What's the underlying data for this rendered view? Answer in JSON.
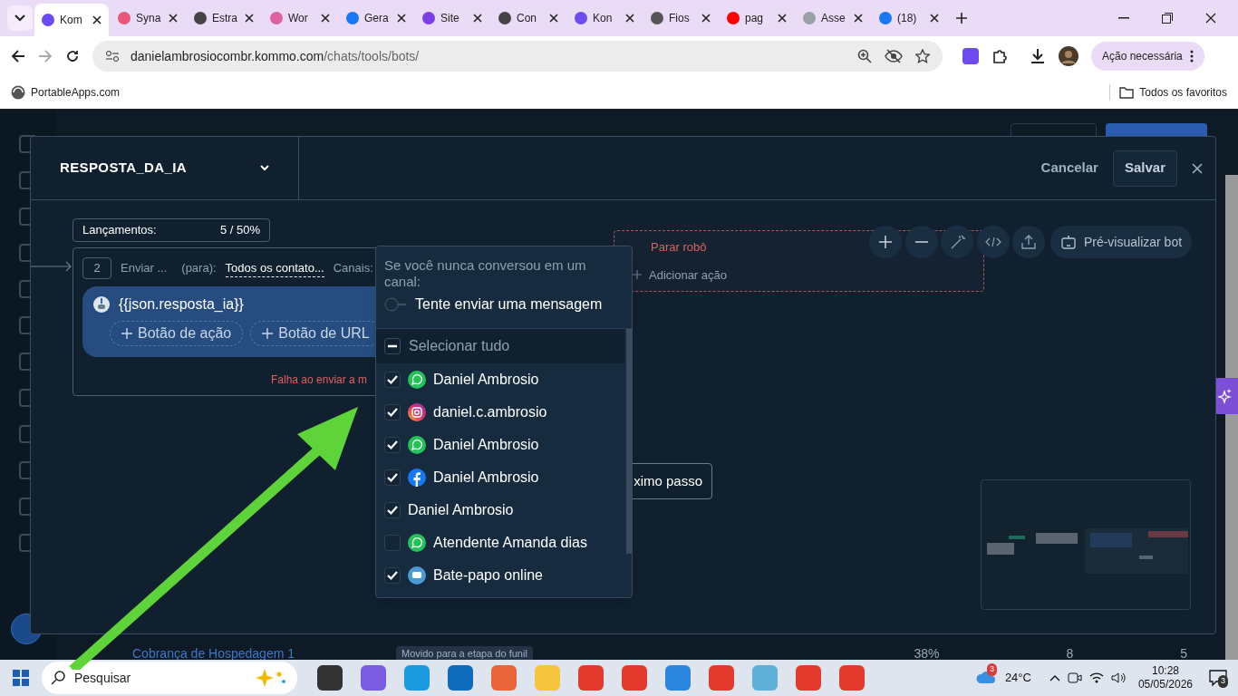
{
  "browser": {
    "tabs": [
      {
        "title": "Kom",
        "color": "#6c4cf0",
        "selected": true
      },
      {
        "title": "Syna",
        "color": "#e8577a",
        "selected": false
      },
      {
        "title": "Estra",
        "color": "#444444",
        "selected": false
      },
      {
        "title": "Wor",
        "color": "#e05fa0",
        "selected": false
      },
      {
        "title": "Gera",
        "color": "#1877f2",
        "selected": false
      },
      {
        "title": "Site",
        "color": "#7b3fe4",
        "selected": false
      },
      {
        "title": "Con",
        "color": "#444444",
        "selected": false
      },
      {
        "title": "Kon",
        "color": "#6c4cf0",
        "selected": false
      },
      {
        "title": "Fios",
        "color": "#555555",
        "selected": false
      },
      {
        "title": "pag",
        "color": "#ff0000",
        "selected": false
      },
      {
        "title": "Asse",
        "color": "#9aa0a6",
        "selected": false
      },
      {
        "title": "(18)",
        "color": "#1877f2",
        "selected": false
      }
    ],
    "address": {
      "host": "danielambrosiocombr.kommo.com",
      "path": "/chats/tools/bots/"
    },
    "action_button": "Ação necessária",
    "bookmarks": [
      "PortableApps.com"
    ],
    "all_bookmarks": "Todos os favoritos"
  },
  "modal": {
    "title": "RESPOSTA_DA_IA",
    "cancel": "Cancelar",
    "save": "Salvar",
    "launches": {
      "label": "Lançamentos:",
      "value": "5 / 50%"
    },
    "step": {
      "number": "2",
      "action": "Enviar ...",
      "to_label": "(para):",
      "to_value": "Todos os contato...",
      "channels_label": "Canais:",
      "message": "{{json.resposta_ia}}",
      "buttons": [
        "Botão de ação",
        "Botão de URL"
      ],
      "error": "Falha ao enviar a m"
    },
    "stop_node": {
      "title": "Parar robô",
      "add": "Adicionar ação"
    },
    "preview_button": "Pré-visualizar bot",
    "next_node": "ximo passo",
    "channel_menu": {
      "hint": "Se você nunca conversou em um canal:",
      "try_send": {
        "label": "Tente enviar uma mensagem",
        "on": false
      },
      "select_all": "Selecionar tudo",
      "channels": [
        {
          "name": "Daniel Ambrosio",
          "kind": "whatsapp",
          "checked": true
        },
        {
          "name": "daniel.c.ambrosio",
          "kind": "instagram",
          "checked": true
        },
        {
          "name": "Daniel Ambrosio",
          "kind": "whatsapp",
          "checked": true
        },
        {
          "name": "Daniel Ambrosio",
          "kind": "facebook",
          "checked": true
        },
        {
          "name": "Daniel Ambrosio",
          "kind": "plain",
          "checked": true
        },
        {
          "name": "Atendente Amanda dias",
          "kind": "whatsapp",
          "checked": false
        },
        {
          "name": "Bate-papo online",
          "kind": "chat",
          "checked": true
        }
      ]
    }
  },
  "background_row": {
    "name": "Cobrança de Hospedagem 1",
    "tag": "Movido para a etapa do funil",
    "percent": "38%",
    "column_4": "8",
    "column_5": "5"
  },
  "taskbar": {
    "search_placeholder": "Pesquisar",
    "weather_badge": "3",
    "temperature": "24°C",
    "time": "10:28",
    "date": "05/05/2026",
    "notifications": "3"
  }
}
